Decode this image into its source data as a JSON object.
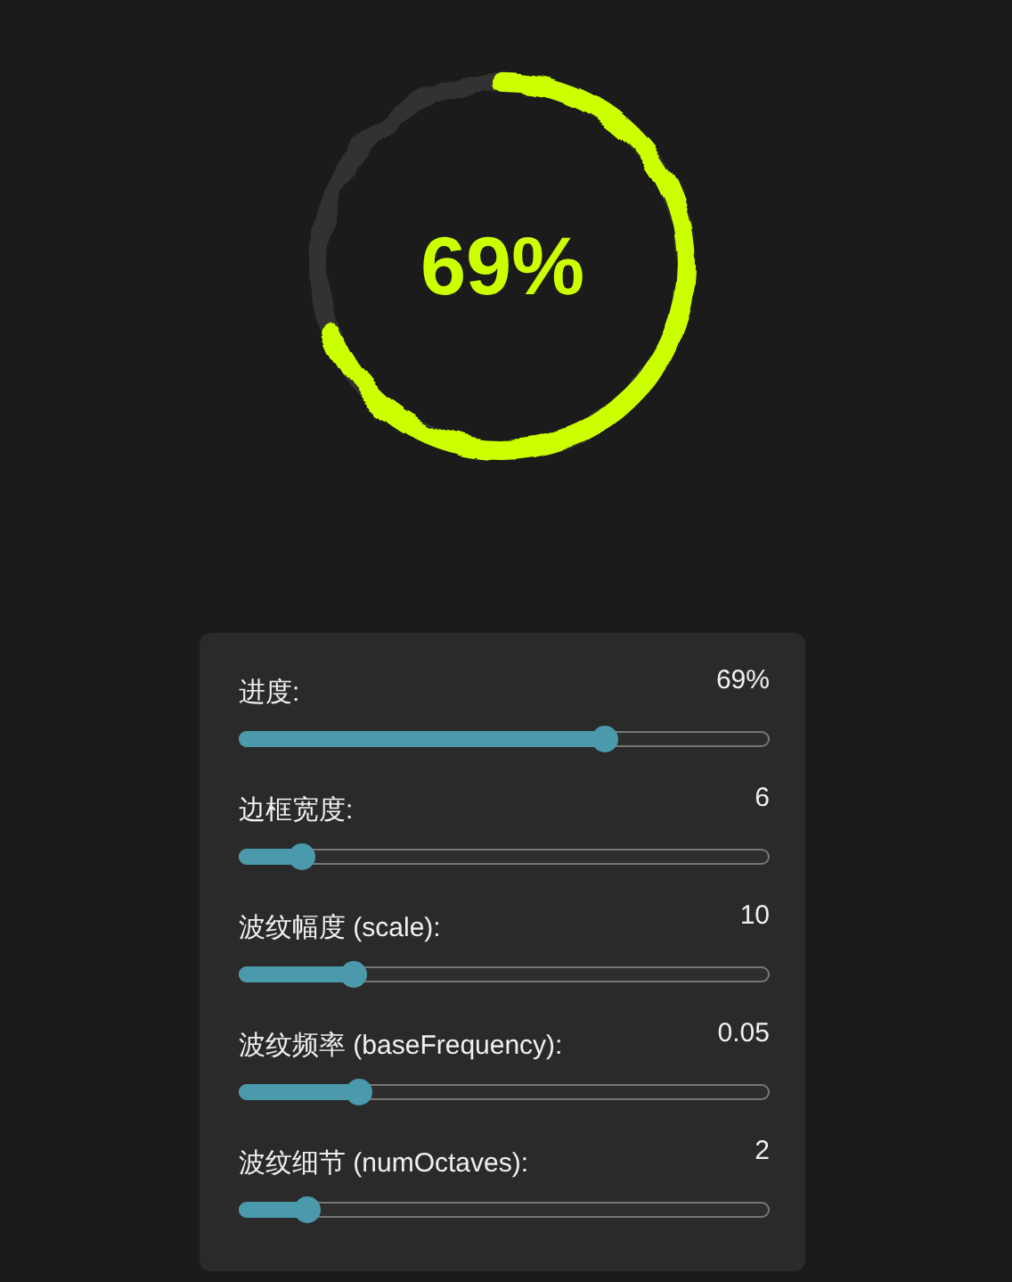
{
  "progress_ring": {
    "label": "69%"
  },
  "controls": [
    {
      "label": "进度:",
      "reading": "69%",
      "level": 0.69
    },
    {
      "label": "边框宽度:",
      "reading": "6",
      "level": 0.12
    },
    {
      "label": "波纹幅度 (scale):",
      "reading": "10",
      "level": 0.215
    },
    {
      "label": "波纹频率 (baseFrequency):",
      "reading": "0.05",
      "level": 0.225
    },
    {
      "label": "波纹细节 (numOctaves):",
      "reading": "2",
      "level": 0.13
    }
  ]
}
